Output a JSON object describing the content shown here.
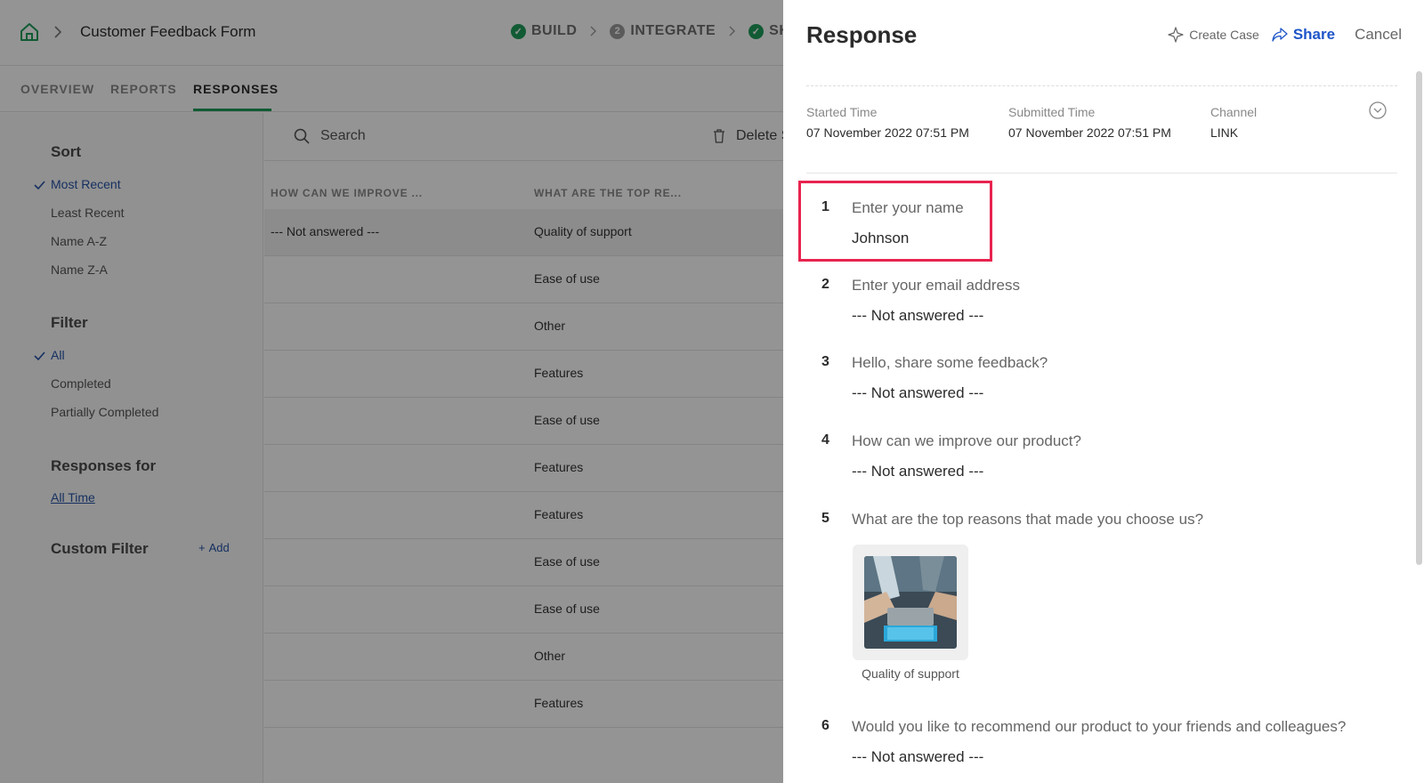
{
  "app": {
    "form_title": "Customer Feedback Form",
    "steps": [
      {
        "label": "BUILD",
        "state": "done"
      },
      {
        "label": "INTEGRATE",
        "state": "2"
      },
      {
        "label": "SHA",
        "state": "done"
      }
    ],
    "tabs": [
      "OVERVIEW",
      "REPORTS",
      "RESPONSES"
    ],
    "active_tab": "RESPONSES",
    "colors": {
      "accent_green": "#1e9e5a",
      "link_blue": "#2653a8",
      "share_blue": "#1f55c9",
      "highlight_red": "#e8234f"
    }
  },
  "sidebar": {
    "sort_heading": "Sort",
    "sort_items": [
      "Most Recent",
      "Least Recent",
      "Name A-Z",
      "Name Z-A"
    ],
    "filter_heading": "Filter",
    "filter_items": [
      "All",
      "Completed",
      "Partially Completed"
    ],
    "responses_for_heading": "Responses for",
    "responses_for_link": "All Time",
    "custom_filter_heading": "Custom Filter",
    "add_label": "Add"
  },
  "list": {
    "search_label": "Search",
    "delete_label": "Delete S",
    "columns": [
      "HOW CAN WE IMPROVE ...",
      "WHAT ARE THE TOP RE..."
    ],
    "rows": [
      [
        "--- Not answered ---",
        "Quality of support"
      ],
      [
        "",
        "Ease of use"
      ],
      [
        "",
        "Other"
      ],
      [
        "",
        "Features"
      ],
      [
        "",
        "Ease of use"
      ],
      [
        "",
        "Features"
      ],
      [
        "",
        "Features"
      ],
      [
        "",
        "Ease of use"
      ],
      [
        "",
        "Ease of use"
      ],
      [
        "",
        "Other"
      ],
      [
        "",
        "Features"
      ]
    ]
  },
  "drawer": {
    "title": "Response",
    "create_case": "Create Case",
    "share": "Share",
    "cancel": "Cancel",
    "meta": [
      {
        "label": "Started Time",
        "value": "07 November 2022 07:51 PM"
      },
      {
        "label": "Submitted Time",
        "value": "07 November 2022 07:51 PM"
      },
      {
        "label": "Channel",
        "value": "LINK"
      }
    ],
    "questions": [
      {
        "num": "1",
        "text": "Enter your name",
        "answer": "Johnson"
      },
      {
        "num": "2",
        "text": "Enter your email address",
        "answer": "--- Not answered ---"
      },
      {
        "num": "3",
        "text": "Hello, share some feedback?",
        "answer": "--- Not answered ---"
      },
      {
        "num": "4",
        "text": "How can we improve our product?",
        "answer": "--- Not answered ---"
      },
      {
        "num": "5",
        "text": "What are the top reasons that made you choose us?",
        "answer": ""
      },
      {
        "num": "6",
        "text": "Would you like to recommend our product to your friends and colleagues?",
        "answer": "--- Not answered ---"
      }
    ],
    "image_caption": "Quality of support"
  }
}
